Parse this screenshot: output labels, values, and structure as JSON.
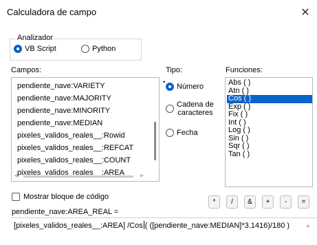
{
  "window": {
    "title": "Calculadora de campo",
    "close_icon": "close-icon"
  },
  "parser": {
    "label": "Analizador",
    "options": [
      {
        "label": "VB Script",
        "selected": true
      },
      {
        "label": "Python",
        "selected": false
      }
    ]
  },
  "fields": {
    "label": "Campos:",
    "items": [
      "pendiente_nave:VARIETY",
      "pendiente_nave:MAJORITY",
      "pendiente_nave:MINORITY",
      "pendiente_nave:MEDIAN",
      "pixeles_validos_reales__:Rowid",
      "pixeles_validos_reales__:REFCAT",
      "pixeles_validos_reales__:COUNT",
      "pixeles_validos_reales__:AREA"
    ]
  },
  "type": {
    "label": "Tipo:",
    "options": [
      {
        "label": "Número",
        "selected": true
      },
      {
        "label_line1": "Cadena de",
        "label_line2": "caracteres",
        "selected": false
      },
      {
        "label": "Fecha",
        "selected": false
      }
    ]
  },
  "functions": {
    "label": "Funciones:",
    "items": [
      "Abs ( )",
      "Atn ( )",
      "Cos ( )",
      "Exp ( )",
      "Fix ( )",
      "Int ( )",
      "Log ( )",
      "Sin ( )",
      "Sqr ( )",
      "Tan ( )"
    ],
    "selected_index": 2
  },
  "show_code_block": {
    "label": "Mostrar bloque de código",
    "checked": false
  },
  "operators": [
    "*",
    "/",
    "&",
    "+",
    "-",
    "="
  ],
  "expression": {
    "label": "pendiente_nave:AREA_REAL =",
    "text_before_caret": "[pixeles_validos_reales__:AREA] /Cos",
    "text_after_caret": "( ([pendiente_nave:MEDIAN]*3.1416)/180 )"
  },
  "colors": {
    "accent": "#0a63c9",
    "selection_text": "#ffffff"
  }
}
